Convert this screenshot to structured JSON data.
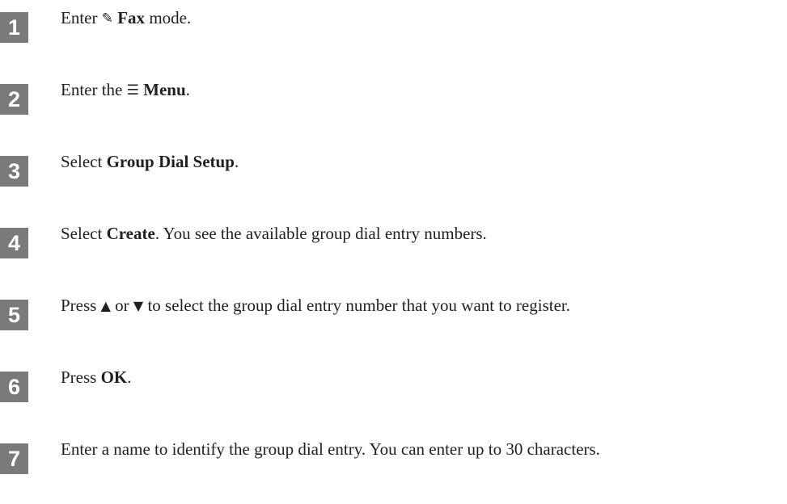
{
  "steps": [
    {
      "number": "1",
      "pre": "Enter ",
      "icon": "✎",
      "icon_name": "fax-mode-icon",
      "bold": "Fax",
      "post": " mode."
    },
    {
      "number": "2",
      "pre": "Enter the ",
      "icon": "☰",
      "icon_name": "menu-icon",
      "bold": "Menu",
      "post": "."
    },
    {
      "number": "3",
      "pre": "Select ",
      "bold": "Group Dial Setup",
      "post": "."
    },
    {
      "number": "4",
      "pre": "Select ",
      "bold": "Create",
      "post": ". You see the available group dial entry numbers."
    },
    {
      "number": "5",
      "pre": "Press ",
      "up": "▲",
      "mid": " or ",
      "down": "▼",
      "post": " to select the group dial entry number that you want to register."
    },
    {
      "number": "6",
      "pre": "Press ",
      "bold": "OK",
      "post": "."
    },
    {
      "number": "7",
      "text": "Enter a name to identify the group dial entry. You can enter up to 30 characters."
    }
  ]
}
